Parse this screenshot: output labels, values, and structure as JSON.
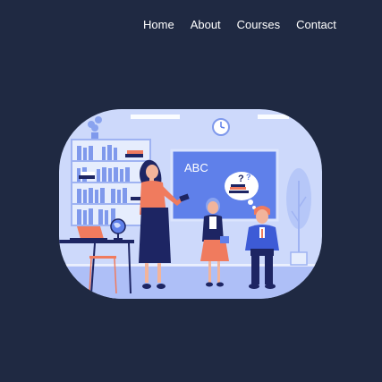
{
  "nav": {
    "items": [
      {
        "label": "Home"
      },
      {
        "label": "About"
      },
      {
        "label": "Courses"
      },
      {
        "label": "Contact"
      }
    ]
  },
  "hero": {
    "board_text": "ABC",
    "bubble_text": "?"
  },
  "colors": {
    "background": "#1f2942",
    "scene_light": "#c9d6fb",
    "scene_floor": "#a9bdf6",
    "board": "#5f80ea",
    "teacher_top": "#f07b5e",
    "teacher_skirt": "#1d2563",
    "boy_jacket": "#3d5bd6"
  }
}
